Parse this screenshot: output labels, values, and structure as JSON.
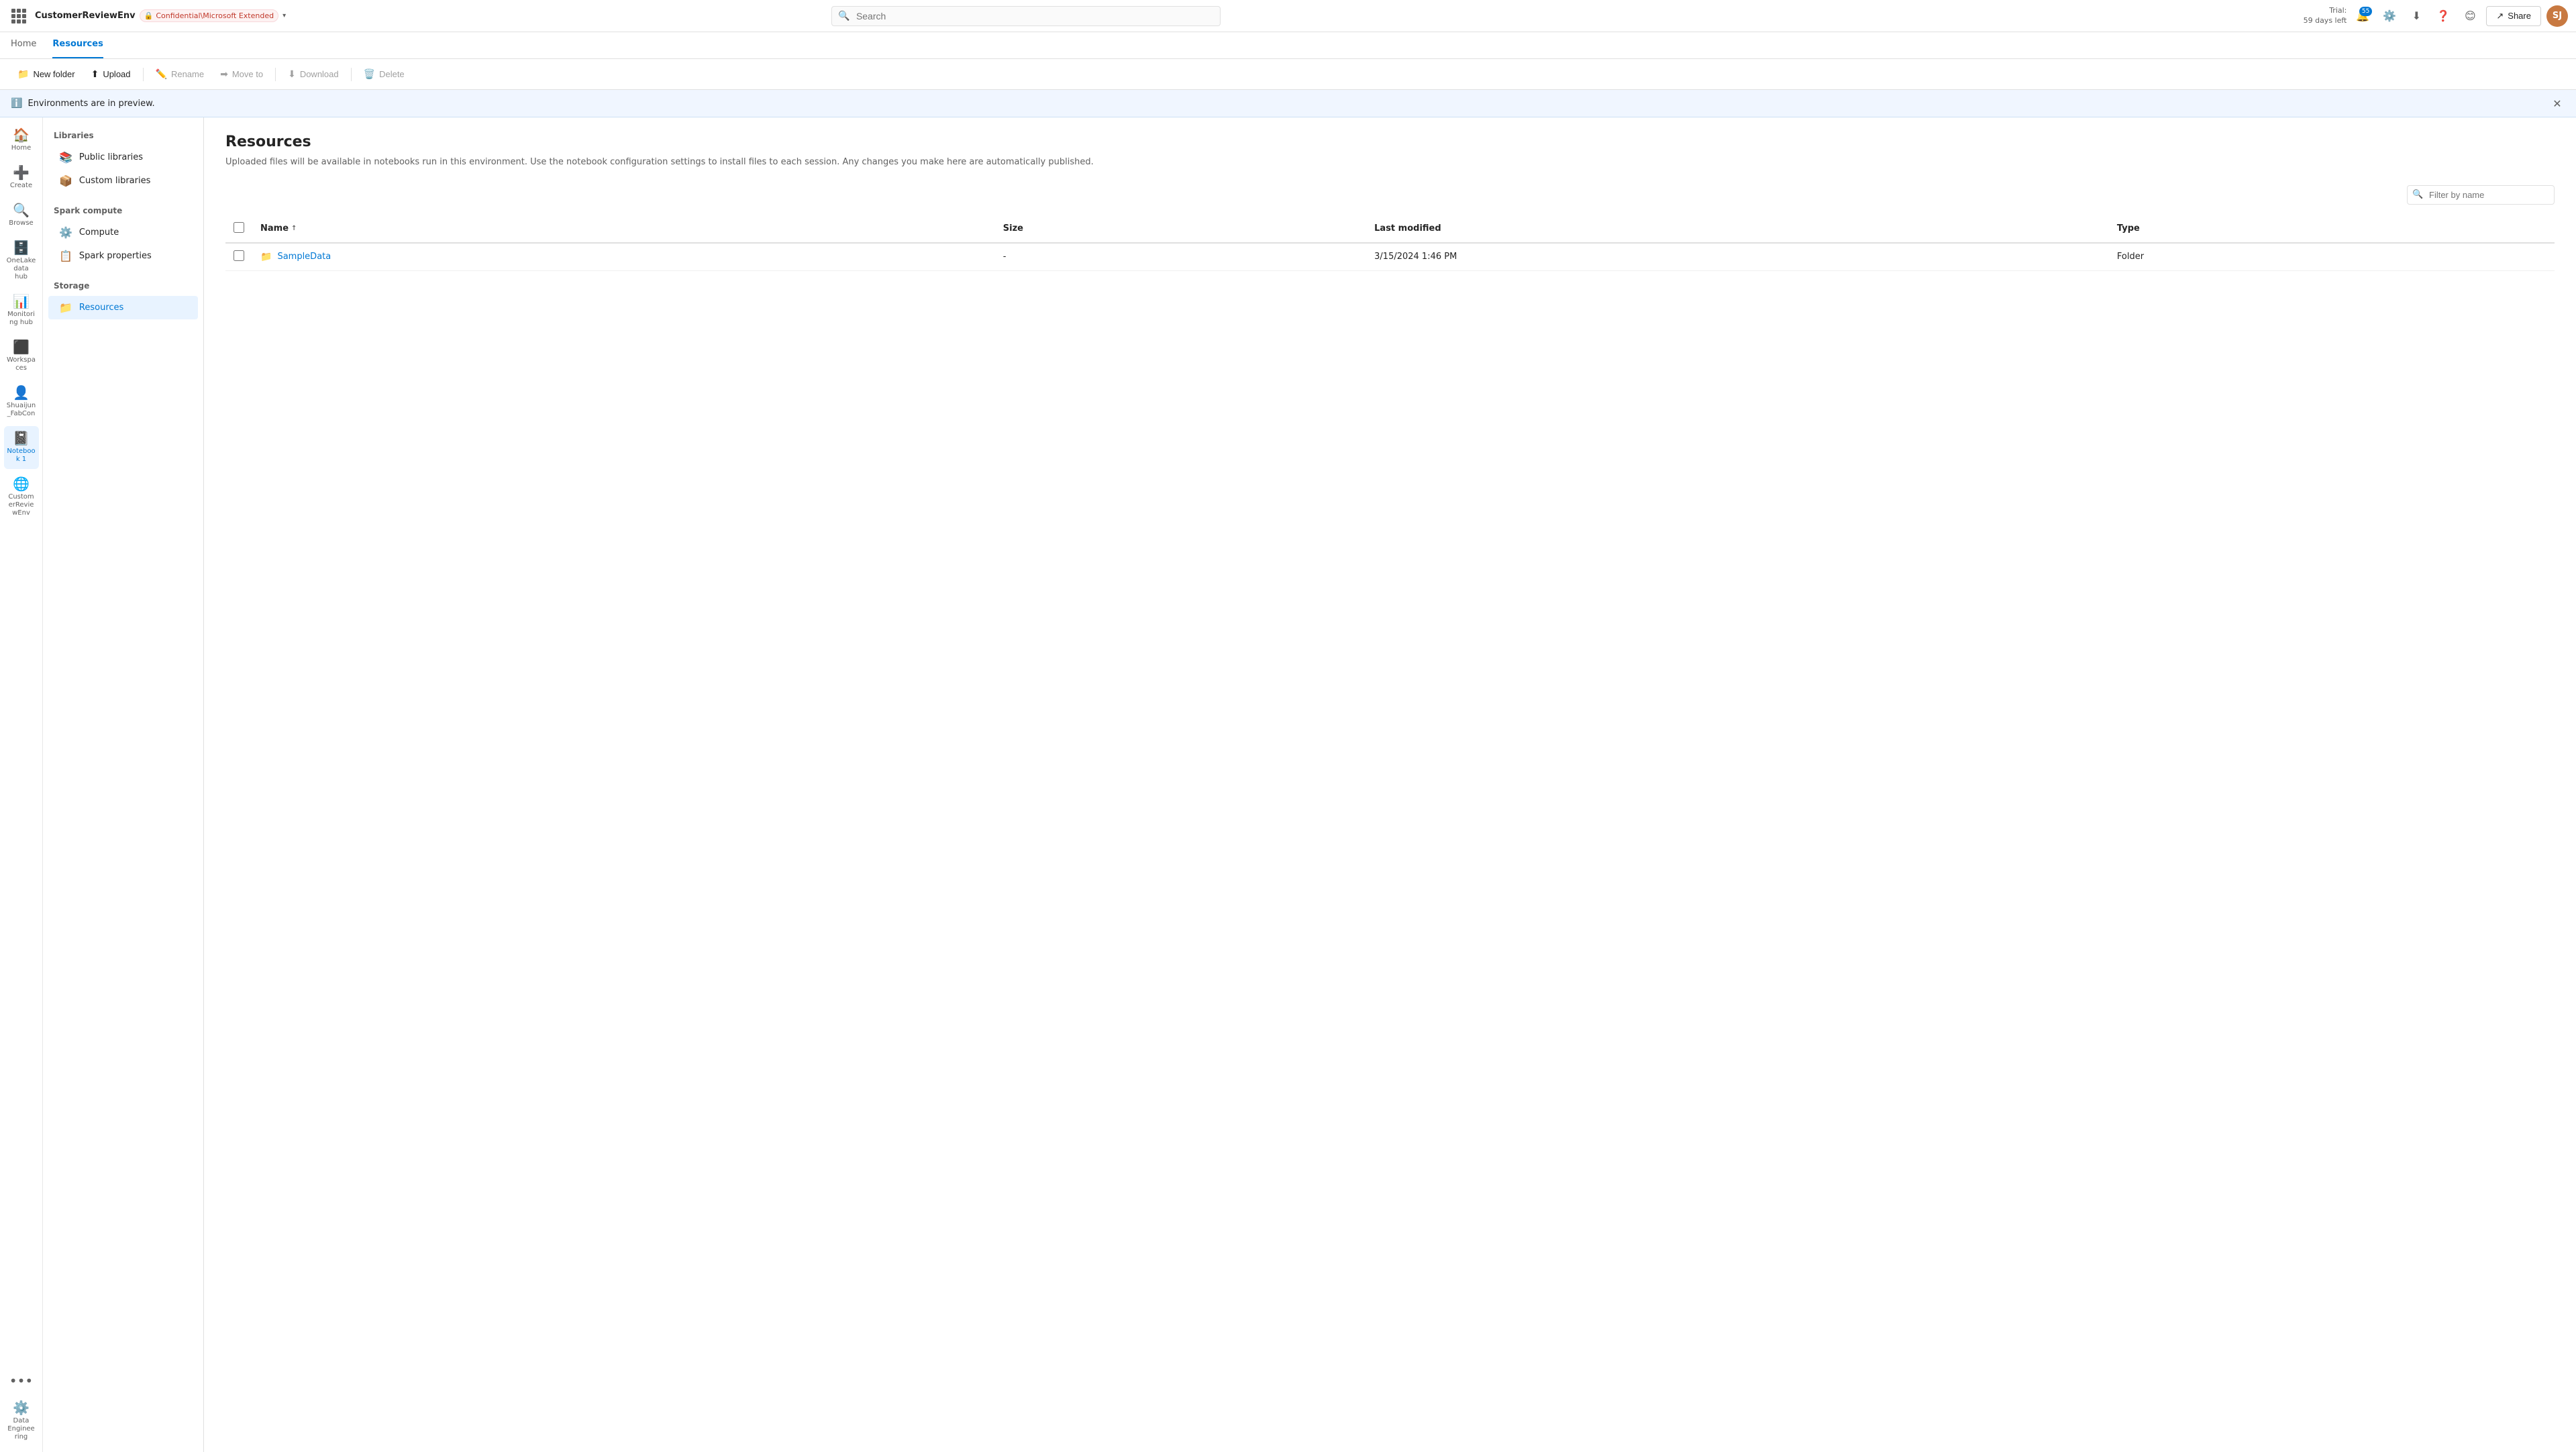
{
  "topbar": {
    "waffle_label": "App launcher",
    "workspace_name": "CustomerReviewEnv",
    "confidentiality": "Confidential\\Microsoft Extended",
    "chevron": "▾",
    "search_placeholder": "Search",
    "trial": {
      "line1": "Trial:",
      "line2": "59 days left"
    },
    "notification_count": "55",
    "share_label": "Share",
    "avatar_initials": "SJ"
  },
  "subnav": {
    "tabs": [
      {
        "id": "home",
        "label": "Home",
        "active": false
      },
      {
        "id": "resources",
        "label": "Resources",
        "active": true
      }
    ]
  },
  "toolbar": {
    "new_folder": "New folder",
    "upload": "Upload",
    "rename": "Rename",
    "move_to": "Move to",
    "download": "Download",
    "delete": "Delete"
  },
  "banner": {
    "text": "Environments are in preview."
  },
  "sidebar": {
    "libraries_section_title": "Libraries",
    "items_libraries": [
      {
        "id": "public-libraries",
        "label": "Public libraries",
        "icon": "📚"
      },
      {
        "id": "custom-libraries",
        "label": "Custom libraries",
        "icon": "📦"
      }
    ],
    "spark_section_title": "Spark compute",
    "items_spark": [
      {
        "id": "compute",
        "label": "Compute",
        "icon": "⚙️"
      },
      {
        "id": "spark-properties",
        "label": "Spark properties",
        "icon": "📋"
      }
    ],
    "storage_section_title": "Storage",
    "items_storage": [
      {
        "id": "resources",
        "label": "Resources",
        "icon": "📁",
        "active": true
      }
    ]
  },
  "rail": {
    "items": [
      {
        "id": "home",
        "label": "Home",
        "icon": "🏠"
      },
      {
        "id": "create",
        "label": "Create",
        "icon": "➕"
      },
      {
        "id": "browse",
        "label": "Browse",
        "icon": "🔍"
      },
      {
        "id": "onelake",
        "label": "OneLake data hub",
        "icon": "🗄️"
      },
      {
        "id": "monitoring",
        "label": "Monitoring hub",
        "icon": "📊"
      },
      {
        "id": "workspaces",
        "label": "Workspaces",
        "icon": "⬛"
      },
      {
        "id": "shaijun",
        "label": "Shuaijun_FabCon",
        "icon": "👤"
      },
      {
        "id": "notebook1",
        "label": "Notebook 1",
        "icon": "📓",
        "active": true
      },
      {
        "id": "customerenv",
        "label": "CustomerReviewEnv",
        "icon": "🌐"
      },
      {
        "id": "data-engineering",
        "label": "Data Engineering",
        "icon": "⚙️"
      }
    ],
    "more_label": "..."
  },
  "content": {
    "title": "Resources",
    "subtitle": "Uploaded files will be available in notebooks run in this environment. Use the notebook configuration settings to install files to each session. Any changes you make here are automatically published.",
    "filter_placeholder": "Filter by name",
    "table": {
      "columns": [
        {
          "id": "name",
          "label": "Name",
          "sortable": true
        },
        {
          "id": "size",
          "label": "Size",
          "sortable": false
        },
        {
          "id": "last-modified",
          "label": "Last modified",
          "sortable": false
        },
        {
          "id": "type",
          "label": "Type",
          "sortable": false
        }
      ],
      "rows": [
        {
          "name": "SampleData",
          "size": "-",
          "last_modified": "3/15/2024 1:46 PM",
          "type": "Folder",
          "is_folder": true
        }
      ]
    }
  }
}
